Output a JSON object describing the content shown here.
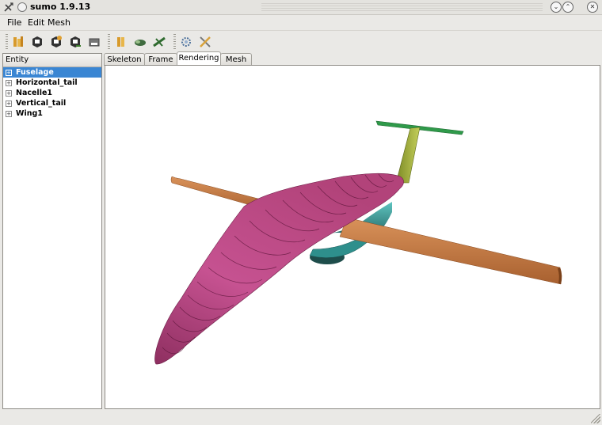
{
  "window": {
    "title": "sumo 1.9.13"
  },
  "menu": [
    {
      "label": "File"
    },
    {
      "label": "Edit"
    },
    {
      "label": "Mesh"
    }
  ],
  "toolbar": {
    "groups": [
      [
        "open-icon",
        "save-icon",
        "save-as-icon",
        "export-icon",
        "print-icon"
      ],
      [
        "new-body-icon",
        "nacelle-icon",
        "new-wing-icon"
      ],
      [
        "settings-icon",
        "tools-icon"
      ]
    ]
  },
  "tree": {
    "header": "Entity",
    "items": [
      {
        "label": "Fuselage",
        "selected": true
      },
      {
        "label": "Horizontal_tail",
        "selected": false
      },
      {
        "label": "Nacelle1",
        "selected": false
      },
      {
        "label": "Vertical_tail",
        "selected": false
      },
      {
        "label": "Wing1",
        "selected": false
      }
    ]
  },
  "tabs": [
    {
      "label": "Skeleton",
      "active": false
    },
    {
      "label": "Frame",
      "active": false
    },
    {
      "label": "Rendering",
      "active": true
    },
    {
      "label": "Mesh",
      "active": false
    }
  ],
  "colors": {
    "fuselage": "#b9477e",
    "wing": "#c97a43",
    "vertical_tail": "#9aa43a",
    "horizontal_tail": "#2f9a4a",
    "nacelle": "#2e8f8c",
    "selection": "#3a86d3"
  }
}
